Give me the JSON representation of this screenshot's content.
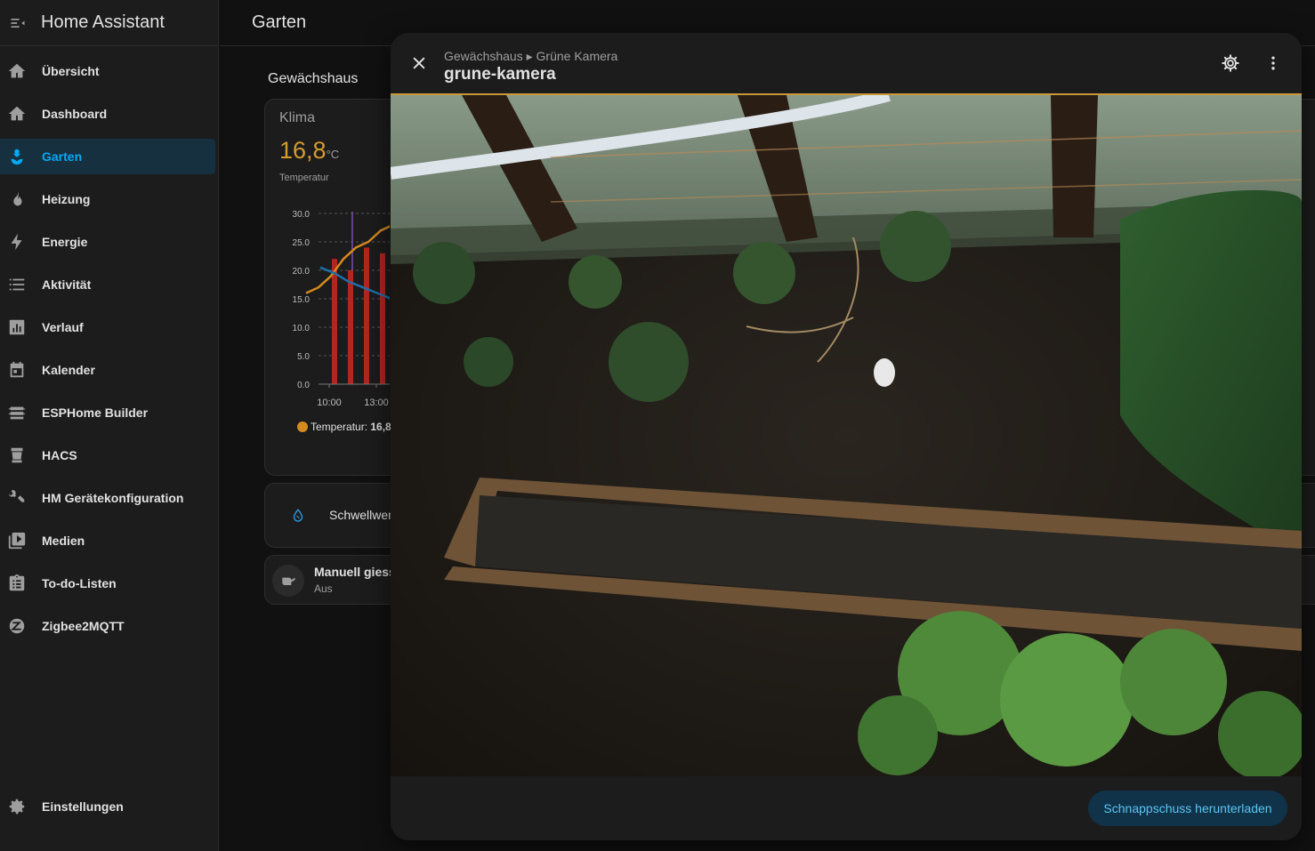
{
  "app": {
    "title": "Home Assistant"
  },
  "sidebar": {
    "items": [
      {
        "label": "Übersicht",
        "icon": "home-icon"
      },
      {
        "label": "Dashboard",
        "icon": "home-icon"
      },
      {
        "label": "Garten",
        "icon": "flower-icon",
        "active": true
      },
      {
        "label": "Heizung",
        "icon": "fire-icon"
      },
      {
        "label": "Energie",
        "icon": "lightning-icon"
      },
      {
        "label": "Aktivität",
        "icon": "list-icon"
      },
      {
        "label": "Verlauf",
        "icon": "chart-box-icon"
      },
      {
        "label": "Kalender",
        "icon": "calendar-icon"
      },
      {
        "label": "ESPHome Builder",
        "icon": "esphome-icon"
      },
      {
        "label": "HACS",
        "icon": "hacs-icon"
      },
      {
        "label": "HM Gerätekonfiguration",
        "icon": "tools-icon"
      },
      {
        "label": "Medien",
        "icon": "media-icon"
      },
      {
        "label": "To-do-Listen",
        "icon": "clipboard-list-icon"
      },
      {
        "label": "Zigbee2MQTT",
        "icon": "zigbee-icon"
      }
    ],
    "settings_label": "Einstellungen"
  },
  "topbar": {
    "title": "Garten"
  },
  "main": {
    "section_title": "Gewächshaus",
    "klima": {
      "name": "Klima",
      "value": "16,8",
      "unit": "°C",
      "sublabel": "Temperatur",
      "legend_label": "Temperatur:",
      "legend_value": "16,8"
    },
    "threshold_label": "Schwellwer",
    "manual": {
      "label": "Manuell giess",
      "state": "Aus"
    }
  },
  "chart_data": {
    "type": "bar",
    "categories": [
      "10:00",
      "",
      "13:00",
      ""
    ],
    "yticks": [
      "30.0",
      "25.0",
      "20.0",
      "15.0",
      "10.0",
      "5.0",
      "0.0"
    ],
    "ylim": [
      0,
      30
    ],
    "bars": [
      22,
      20,
      24,
      23
    ],
    "temperature_line": [
      16,
      17,
      19,
      22,
      24,
      25,
      27,
      28
    ],
    "humidity_line": [
      20.5,
      19.5,
      18,
      17,
      16,
      15
    ],
    "colors": {
      "bars": "#b3261e",
      "temperature": "#d68a1e",
      "humidity": "#1f6fa8",
      "marker": "#7b4fb0"
    }
  },
  "dialog": {
    "breadcrumb": "Gewächshaus ▸ Grüne Kamera",
    "title": "grune-kamera",
    "download_button": "Schnappschuss herunterladen"
  }
}
